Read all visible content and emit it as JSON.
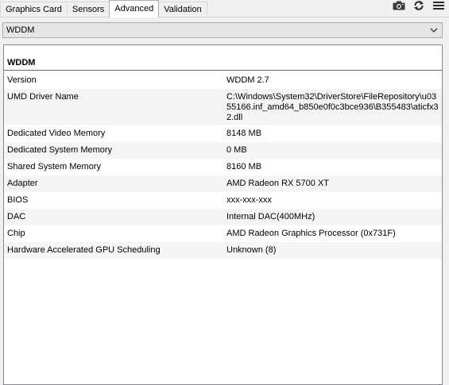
{
  "tabs": [
    {
      "label": "Graphics Card",
      "active": false
    },
    {
      "label": "Sensors",
      "active": false
    },
    {
      "label": "Advanced",
      "active": true
    },
    {
      "label": "Validation",
      "active": false
    }
  ],
  "toolbar": {
    "icons": [
      "camera-icon",
      "refresh-icon",
      "menu-icon"
    ]
  },
  "dropdown": {
    "selected": "WDDM"
  },
  "section": {
    "title": "WDDM"
  },
  "rows": [
    {
      "label": "Version",
      "value": "WDDM 2.7"
    },
    {
      "label": "UMD Driver Name",
      "value": "C:\\Windows\\System32\\DriverStore\\FileRepository\\u0355166.inf_amd64_b850e0f0c3bce936\\B355483\\aticfx32.dll"
    },
    {
      "label": "Dedicated Video Memory",
      "value": "8148 MB"
    },
    {
      "label": "Dedicated System Memory",
      "value": "0 MB"
    },
    {
      "label": "Shared System Memory",
      "value": "8160 MB"
    },
    {
      "label": "Adapter",
      "value": "AMD Radeon RX 5700 XT"
    },
    {
      "label": "BIOS",
      "value": "xxx-xxx-xxx"
    },
    {
      "label": "DAC",
      "value": "Internal DAC(400MHz)"
    },
    {
      "label": "Chip",
      "value": "AMD Radeon Graphics Processor (0x731F)"
    },
    {
      "label": "Hardware Accelerated GPU Scheduling",
      "value": "Unknown (8)"
    }
  ]
}
